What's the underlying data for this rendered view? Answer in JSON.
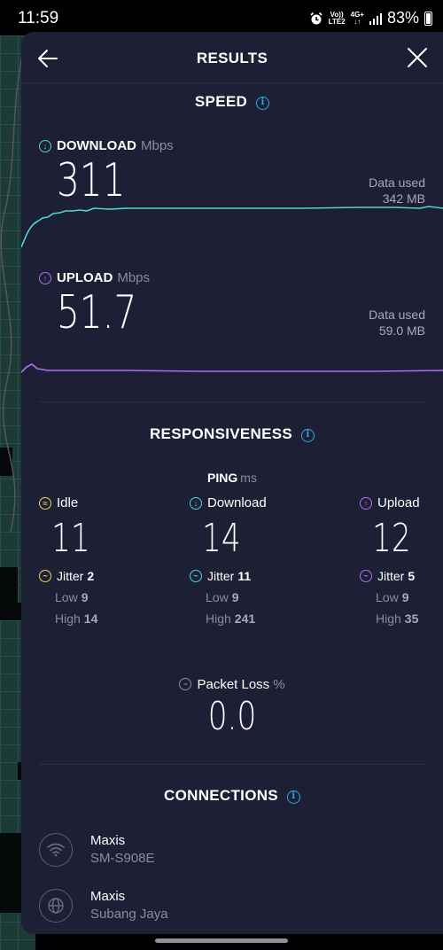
{
  "status_bar": {
    "time": "11:59",
    "battery": "83%",
    "net_top": "Vo))",
    "net_bottom": "LTE2",
    "gen": "4G+"
  },
  "header": {
    "title": "RESULTS"
  },
  "speed": {
    "title": "SPEED",
    "download": {
      "label": "DOWNLOAD",
      "unit": "Mbps",
      "value": "311",
      "data_used_label": "Data used",
      "data_used_value": "342 MB",
      "color": "#4fd6cf"
    },
    "upload": {
      "label": "UPLOAD",
      "unit": "Mbps",
      "value": "51.7",
      "data_used_label": "Data used",
      "data_used_value": "59.0 MB",
      "color": "#b06ff2"
    }
  },
  "responsiveness": {
    "title": "RESPONSIVENESS",
    "ping": {
      "label": "PING",
      "unit": "ms"
    },
    "columns": [
      {
        "label": "Idle",
        "value": "11",
        "jitter_label": "Jitter",
        "jitter": "2",
        "low_label": "Low",
        "low": "9",
        "high_label": "High",
        "high": "14"
      },
      {
        "label": "Download",
        "value": "14",
        "jitter_label": "Jitter",
        "jitter": "11",
        "low_label": "Low",
        "low": "9",
        "high_label": "High",
        "high": "241"
      },
      {
        "label": "Upload",
        "value": "12",
        "jitter_label": "Jitter",
        "jitter": "5",
        "low_label": "Low",
        "low": "9",
        "high_label": "High",
        "high": "35"
      }
    ],
    "packet_loss": {
      "label": "Packet Loss",
      "unit": "%",
      "value": "0.0"
    }
  },
  "connections": {
    "title": "CONNECTIONS",
    "items": [
      {
        "title": "Maxis",
        "subtitle": "SM-S908E",
        "icon": "wifi-icon"
      },
      {
        "title": "Maxis",
        "subtitle": "Subang Jaya",
        "icon": "globe-icon"
      }
    ]
  }
}
